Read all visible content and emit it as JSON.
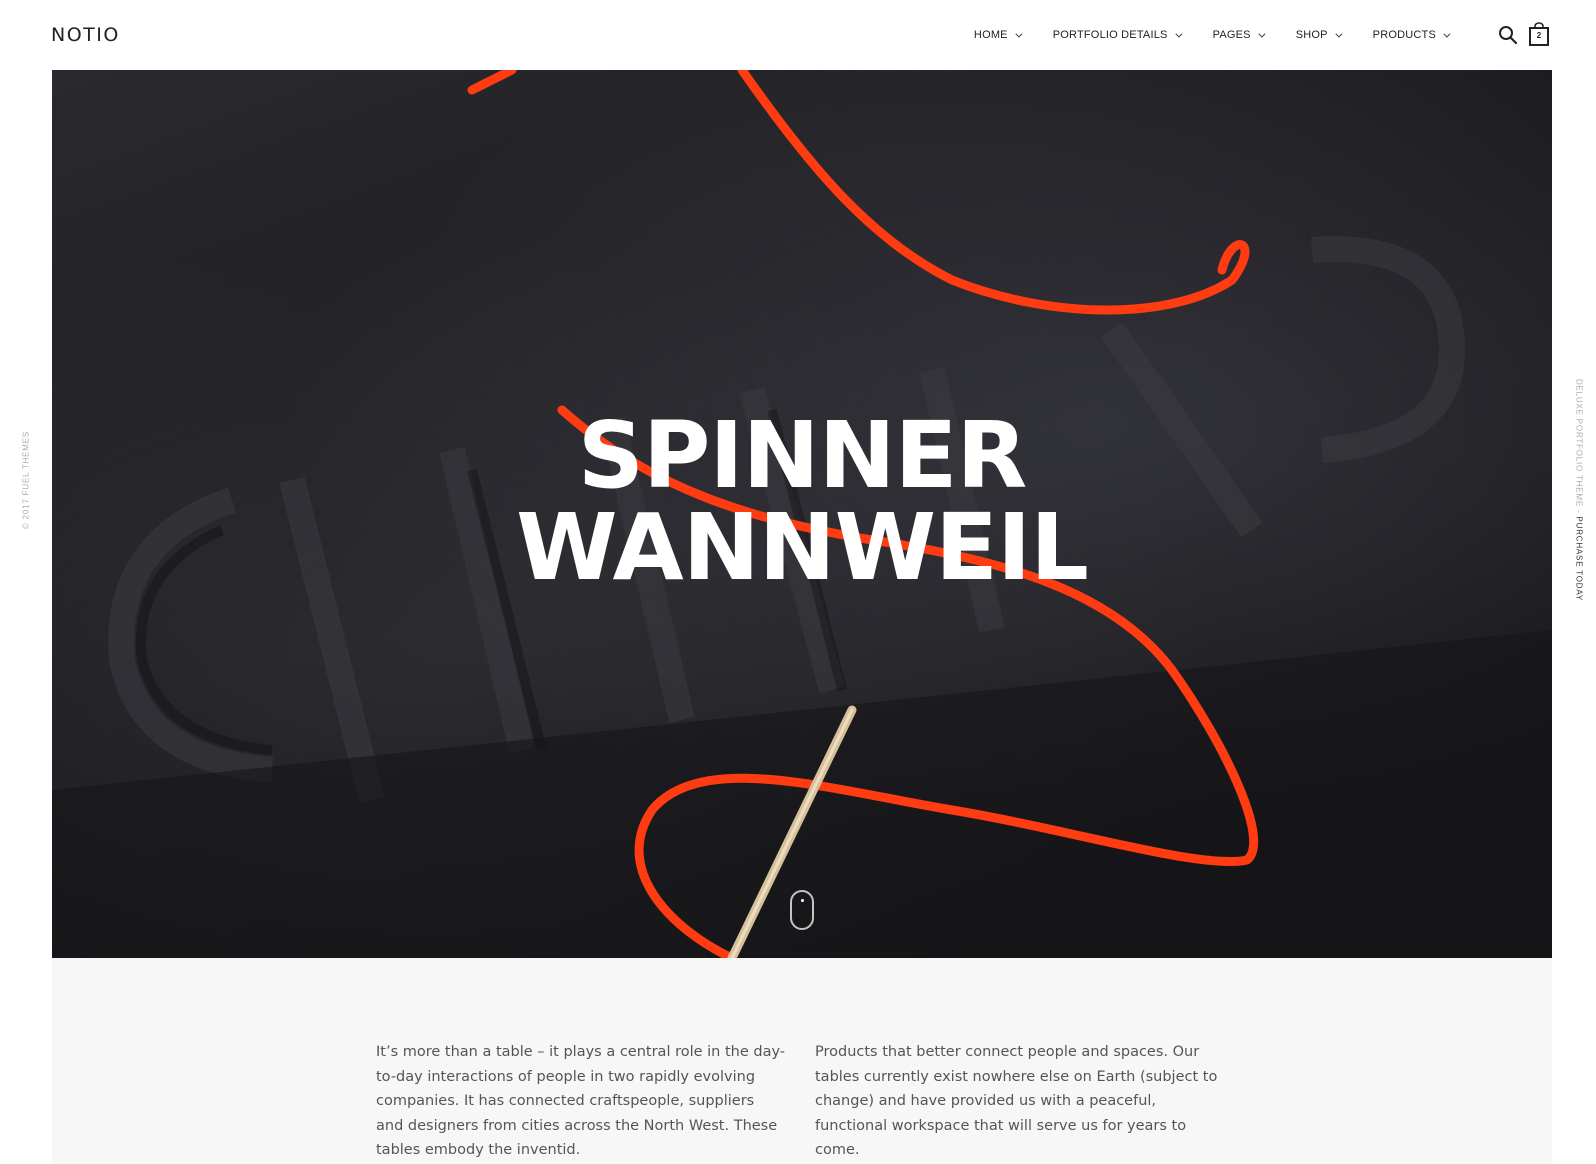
{
  "header": {
    "logo": "NOTIO",
    "nav": [
      {
        "label": "HOME"
      },
      {
        "label": "PORTFOLIO DETAILS"
      },
      {
        "label": "PAGES"
      },
      {
        "label": "SHOP"
      },
      {
        "label": "PRODUCTS"
      }
    ],
    "cart_count": "2"
  },
  "side": {
    "left_text": "© 2017 FUEL THEMES",
    "right_text": "DELUXE PORTFOLIO THEME - ",
    "right_cta": "PURCHASE TODAY"
  },
  "hero": {
    "title_line1": "SPINNER",
    "title_line2": "WANNWEIL"
  },
  "content": {
    "col1": "It’s more than a table – it plays a central role in the day-to-day interactions of people in two rapidly evolving companies. It has connected craftspeople, suppliers and designers from cities across the North West. These tables embody the inventid.",
    "col2": "Products that better connect people and spaces. Our tables currently exist nowhere else on Earth (subject to change) and have provided us with a peaceful, functional workspace that will serve us for years to come."
  },
  "colors": {
    "thread": "#ff3b12",
    "hero_dark": "#1b1b1f",
    "content_bg": "#f7f7f7"
  }
}
